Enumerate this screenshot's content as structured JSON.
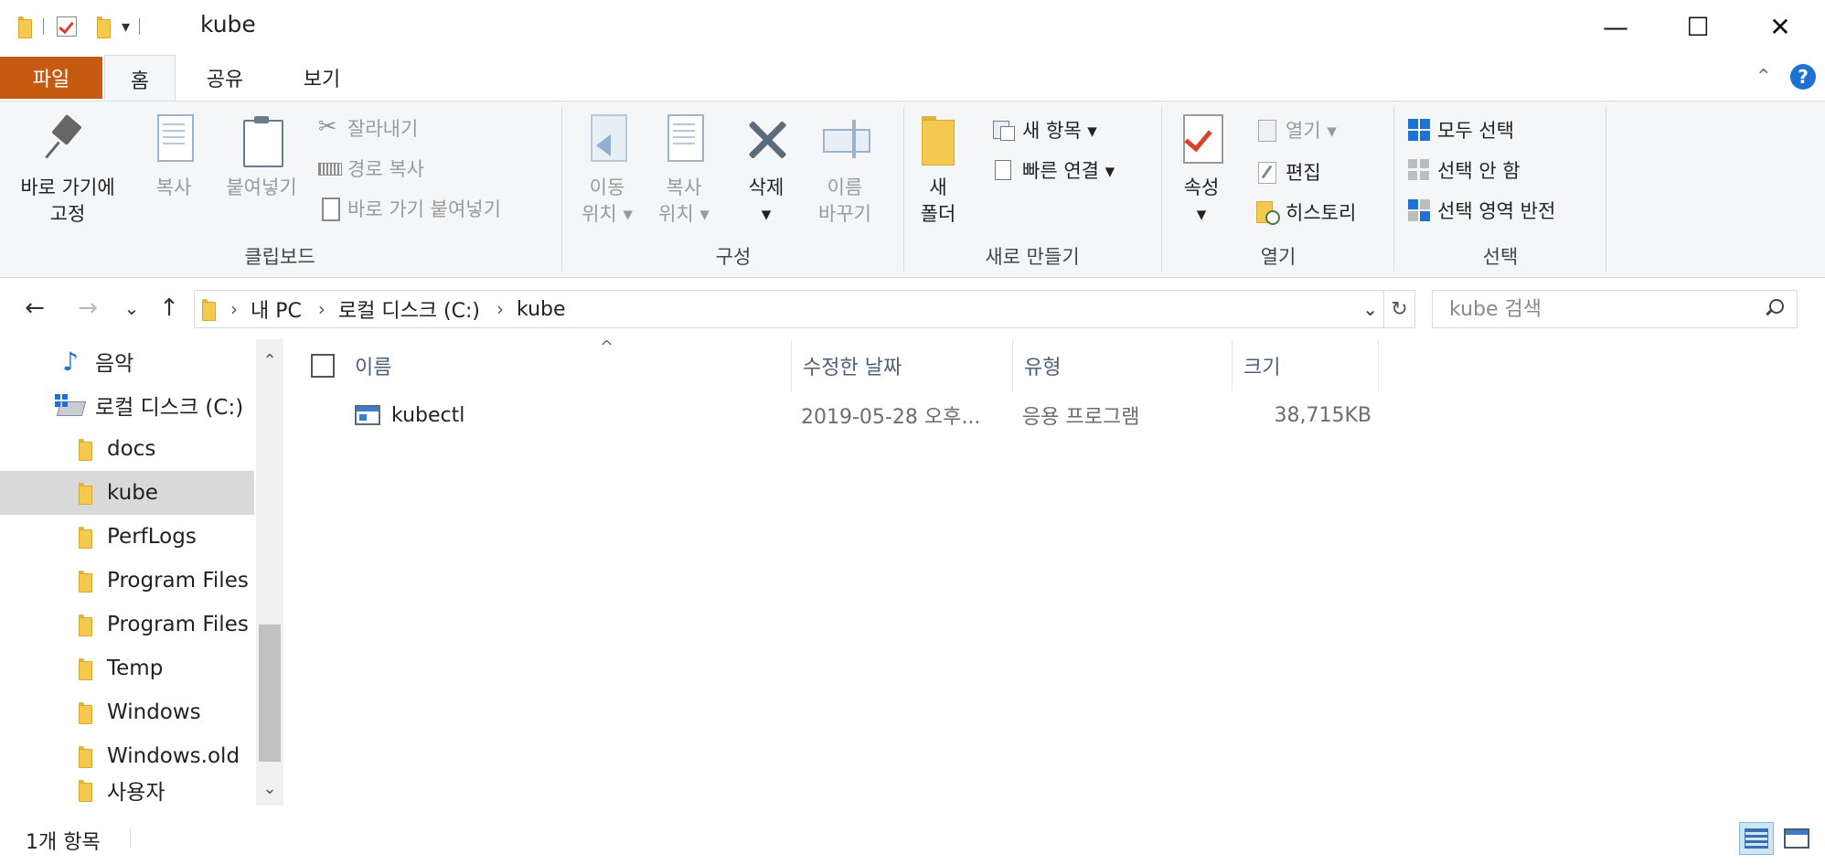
{
  "window": {
    "title": "kube",
    "minimize_glyph": "—",
    "maximize_glyph": "☐",
    "close_glyph": "✕",
    "qa_dropdown_glyph": "▾"
  },
  "ribbon_tabs": [
    {
      "label": "파일"
    },
    {
      "label": "홈"
    },
    {
      "label": "공유"
    },
    {
      "label": "보기"
    }
  ],
  "ribbon": {
    "clipboard": {
      "label": "클립보드",
      "pin_line1": "바로 가기에",
      "pin_line2": "고정",
      "copy": "복사",
      "paste": "붙여넣기",
      "cut": "잘라내기",
      "copy_path": "경로 복사",
      "paste_shortcut": "바로 가기 붙여넣기"
    },
    "organize": {
      "label": "구성",
      "move_line1": "이동",
      "move_line2": "위치 ▾",
      "copyto_line1": "복사",
      "copyto_line2": "위치 ▾",
      "delete_line1": "삭제",
      "delete_line2": "▾",
      "rename_line1": "이름",
      "rename_line2": "바꾸기"
    },
    "new": {
      "label": "새로 만들기",
      "folder_line1": "새",
      "folder_line2": "폴더",
      "new_item": "새 항목 ▾",
      "easy_access": "빠른 연결 ▾"
    },
    "open": {
      "label": "열기",
      "properties_line1": "속성",
      "properties_line2": "▾",
      "open": "열기 ▾",
      "edit": "편집",
      "history": "히스토리"
    },
    "select": {
      "label": "선택",
      "select_all": "모두 선택",
      "select_none": "선택 안 함",
      "invert": "선택 영역 반전"
    }
  },
  "nav": {
    "back": "←",
    "forward": "→",
    "recent": "⌄",
    "up": "↑",
    "breadcrumb": [
      "내 PC",
      "로컬 디스크 (C:)",
      "kube"
    ],
    "crumb_sep": "›",
    "addr_dropdown": "⌄",
    "refresh": "↻",
    "search_placeholder": "kube 검색"
  },
  "tree": [
    {
      "label": "음악",
      "icon": "music-icon"
    },
    {
      "label": "로컬 디스크 (C:)",
      "icon": "disk-icon"
    },
    {
      "label": "docs",
      "icon": "folder-icon"
    },
    {
      "label": "kube",
      "icon": "folder-icon",
      "selected": true
    },
    {
      "label": "PerfLogs",
      "icon": "folder-icon"
    },
    {
      "label": "Program Files",
      "icon": "folder-icon"
    },
    {
      "label": "Program Files",
      "icon": "folder-icon"
    },
    {
      "label": "Temp",
      "icon": "folder-icon"
    },
    {
      "label": "Windows",
      "icon": "folder-icon"
    },
    {
      "label": "Windows.old",
      "icon": "folder-icon"
    },
    {
      "label": "사용자",
      "icon": "folder-icon"
    }
  ],
  "scroll": {
    "up": "⌃",
    "down": "⌄"
  },
  "columns": {
    "name": "이름",
    "date": "수정한 날짜",
    "type": "유형",
    "size": "크기",
    "sort_glyph": "^"
  },
  "files": [
    {
      "name": "kubectl",
      "date": "2019-05-28 오후...",
      "type": "응용 프로그램",
      "size": "38,715KB",
      "icon": "exe-icon"
    }
  ],
  "status": {
    "count": "1개 항목"
  }
}
